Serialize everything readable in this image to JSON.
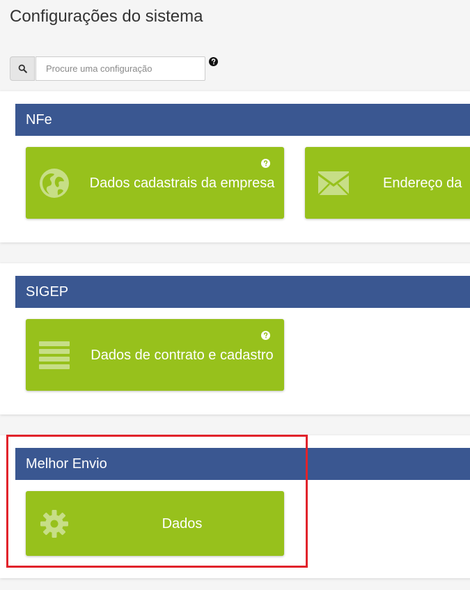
{
  "page": {
    "title": "Configurações do sistema"
  },
  "search": {
    "placeholder": "Procure uma configuração",
    "value": "",
    "icon": "search-icon",
    "help_icon": "question-circle-icon"
  },
  "colors": {
    "section_header": "#3a5791",
    "tile": "#97c11c",
    "highlight": "#e1232b"
  },
  "sections": [
    {
      "title": "NFe",
      "tiles": [
        {
          "label": "Dados cadastrais da empresa",
          "icon": "globe-icon",
          "has_help": true
        },
        {
          "label": "Endereço da",
          "icon": "envelope-icon",
          "has_help": false
        }
      ]
    },
    {
      "title": "SIGEP",
      "tiles": [
        {
          "label": "Dados de contrato e cadastro",
          "icon": "list-icon",
          "has_help": true
        }
      ]
    },
    {
      "title": "Melhor Envio",
      "tiles": [
        {
          "label": "Dados",
          "icon": "gear-icon",
          "has_help": false
        }
      ]
    }
  ]
}
